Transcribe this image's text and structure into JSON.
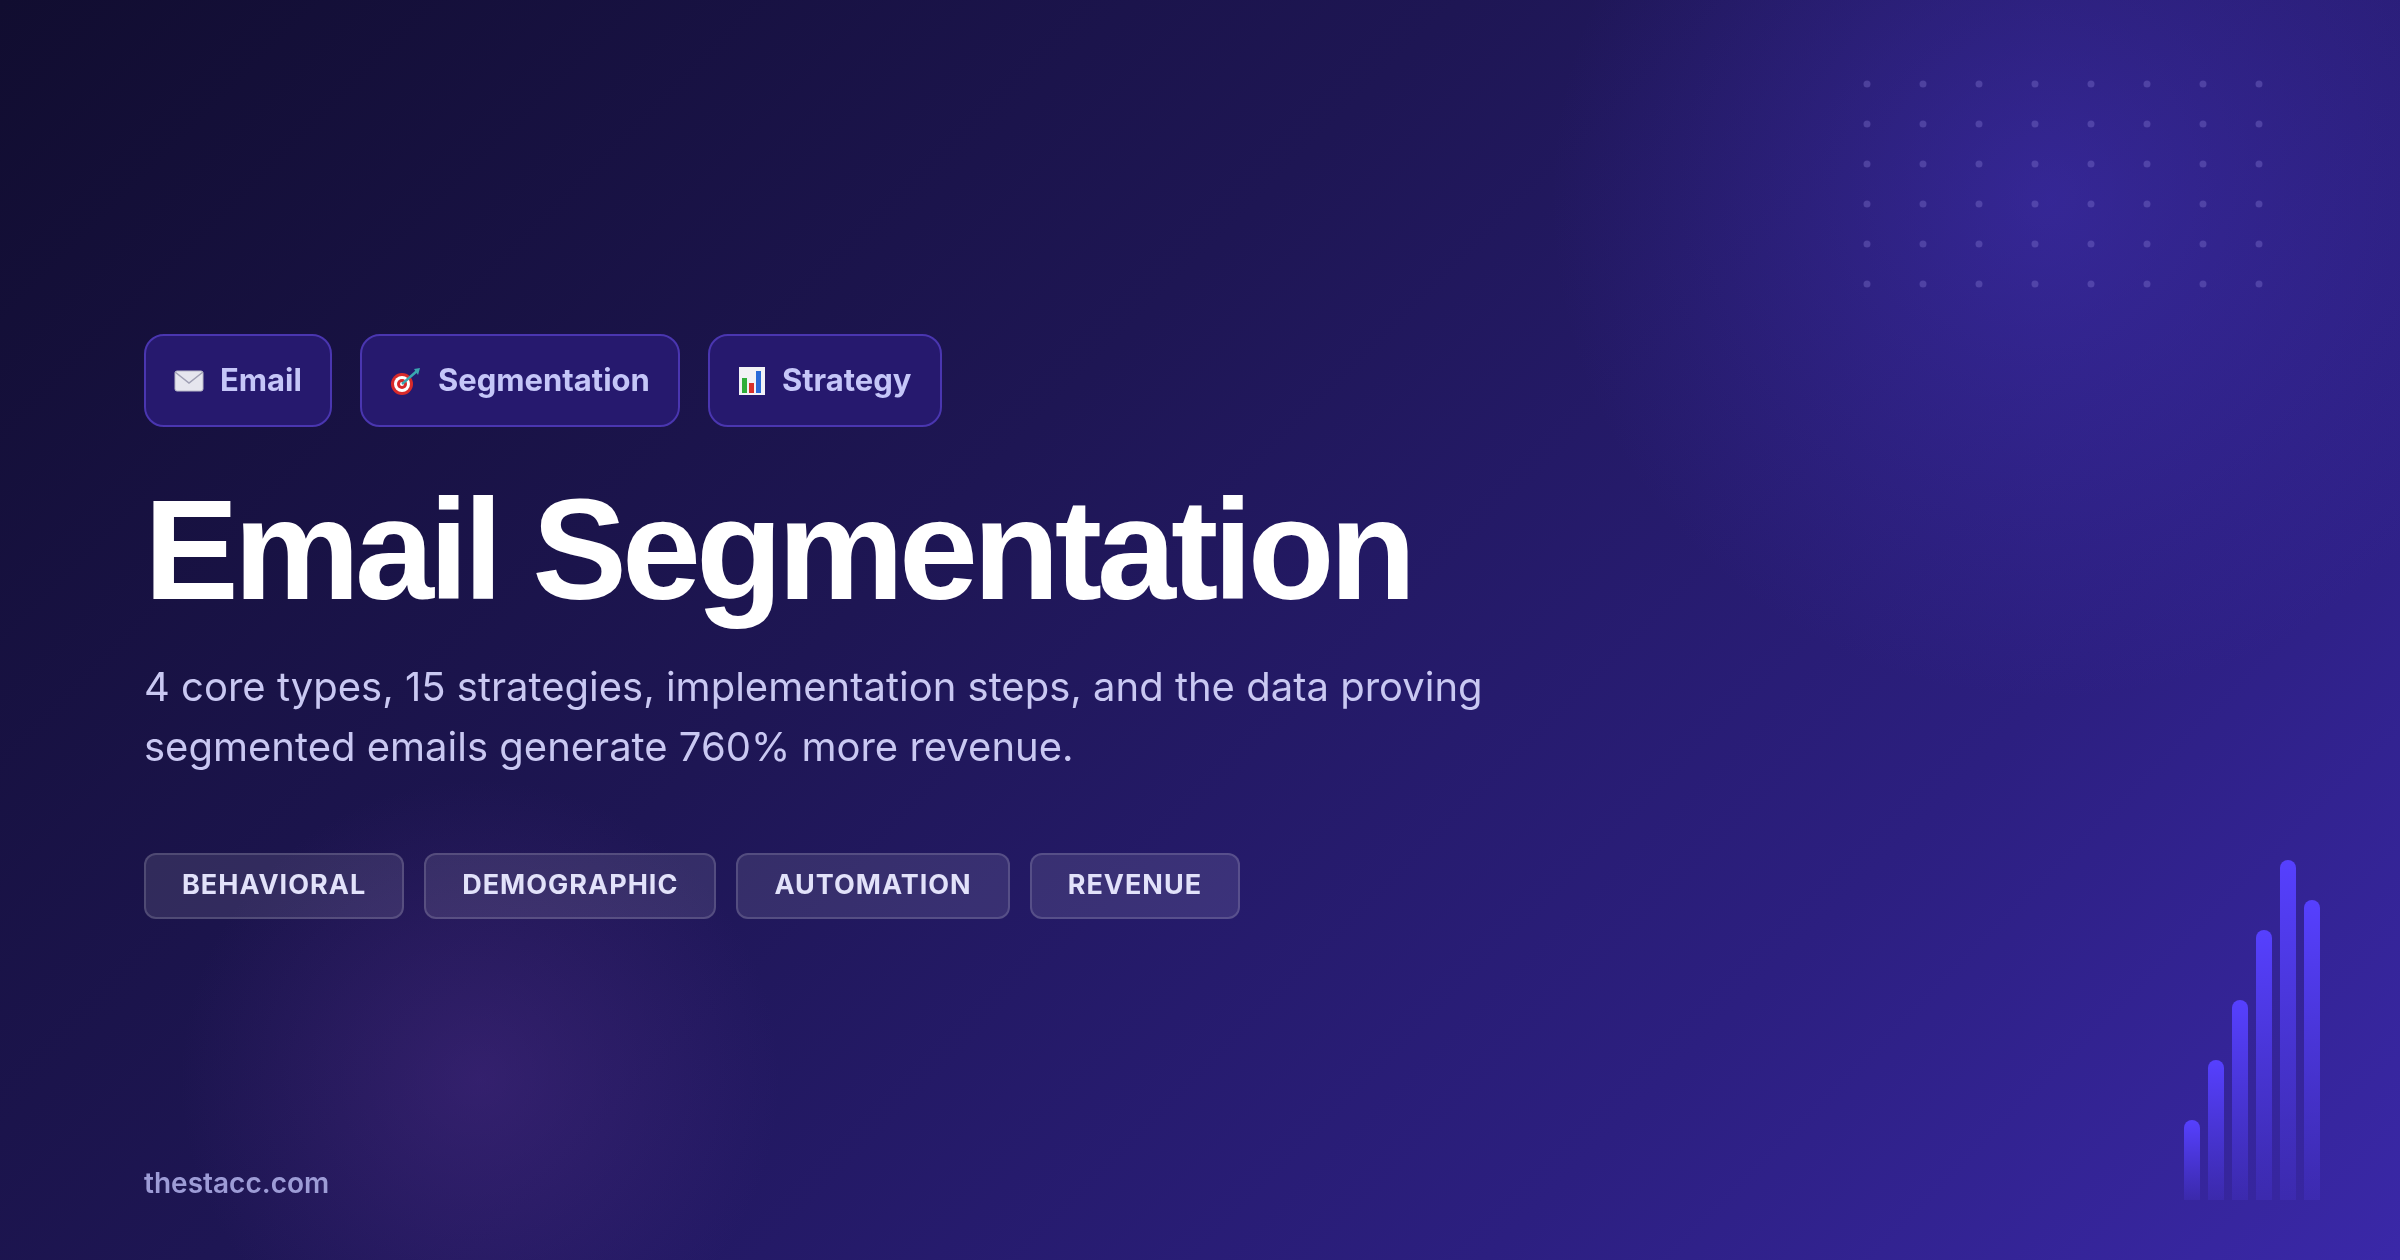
{
  "category_badges": [
    {
      "kind": "envelope",
      "label": "Email"
    },
    {
      "kind": "target",
      "label": "Segmentation"
    },
    {
      "kind": "chart",
      "label": "Strategy"
    }
  ],
  "title": "Email Segmentation",
  "subtitle": "4 core types, 15 strategies, implementation steps, and the data proving segmented emails generate 760% more revenue.",
  "tags": [
    "BEHAVIORAL",
    "DEMOGRAPHIC",
    "AUTOMATION",
    "REVENUE"
  ],
  "footer": {
    "site": "thestacc.com"
  }
}
